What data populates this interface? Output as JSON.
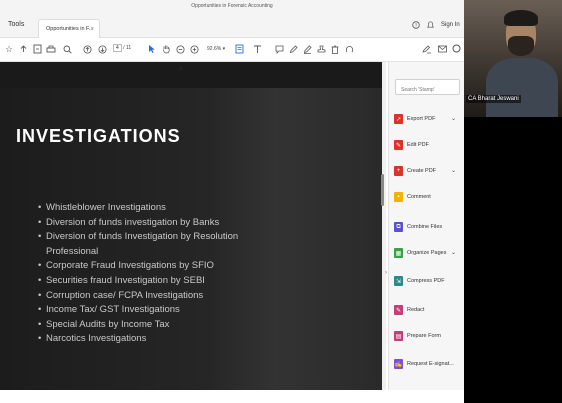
{
  "window": {
    "doc_title": "Opportunities in Forensic Accounting"
  },
  "tabbar": {
    "tools_label": "Tools",
    "tab_label": "Opportunities in F...",
    "tab_close": "×",
    "signin_label": "Sign In"
  },
  "toolbar": {
    "page_current": "4",
    "page_total": "/ 11",
    "zoom_level": "92.6%"
  },
  "slide": {
    "title": "INVESTIGATIONS",
    "bullets": [
      "Whistleblower Investigations",
      "Diversion of funds investigation by Banks",
      "Diversion of funds Investigation by Resolution",
      "Professional",
      "Corporate Fraud Investigations by SFIO",
      "Securities fraud Investigation by SEBI",
      "Corruption case/ FCPA Investigations",
      "Income Tax/ GST Investigations",
      "Special Audits by Income Tax",
      "Narcotics Investigations"
    ],
    "bullet_glyph": "•"
  },
  "right_panel": {
    "search_placeholder": "Search 'Stamp'",
    "items": [
      {
        "label": "Export PDF",
        "icon": "export-pdf-icon",
        "color": "#d9342b",
        "has_chevron": true
      },
      {
        "label": "Edit PDF",
        "icon": "edit-pdf-icon",
        "color": "#d9342b",
        "has_chevron": false
      },
      {
        "label": "Create PDF",
        "icon": "create-pdf-icon",
        "color": "#d9342b",
        "has_chevron": true
      },
      {
        "label": "Comment",
        "icon": "comment-icon",
        "color": "#f2b200",
        "has_chevron": false
      },
      {
        "label": "Combine Files",
        "icon": "combine-files-icon",
        "color": "#5a4fd6",
        "has_chevron": false
      },
      {
        "label": "Organize Pages",
        "icon": "organize-pages-icon",
        "color": "#3aa04a",
        "has_chevron": true
      },
      {
        "label": "Compress PDF",
        "icon": "compress-pdf-icon",
        "color": "#2d8a8a",
        "has_chevron": false
      },
      {
        "label": "Redact",
        "icon": "redact-icon",
        "color": "#c43e78",
        "has_chevron": false
      },
      {
        "label": "Prepare Form",
        "icon": "prepare-form-icon",
        "color": "#c43e78",
        "has_chevron": false
      },
      {
        "label": "Request E-signat...",
        "icon": "request-esign-icon",
        "color": "#7b52c9",
        "has_chevron": false
      }
    ],
    "chevron": "⌄"
  },
  "video": {
    "participant_name": "CA Bharat Jeswani"
  },
  "colors": {
    "slide_bg": "#222222",
    "slide_title": "#ffffff",
    "bullet_text": "#c8c8c8",
    "accent_blue": "#2d6ad8"
  }
}
